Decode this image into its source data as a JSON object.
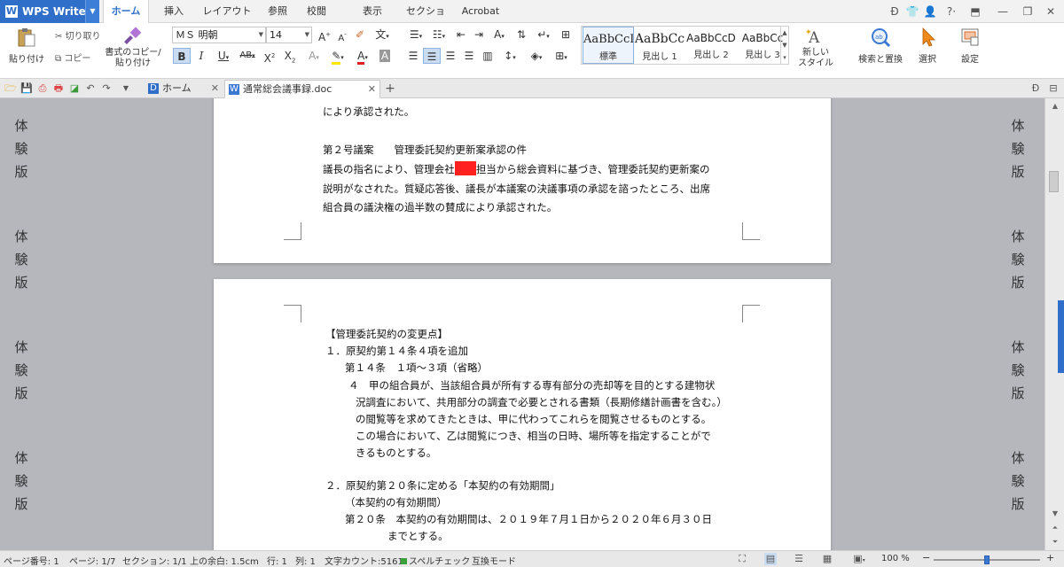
{
  "app": {
    "name": "WPS Writer"
  },
  "menu": [
    "ホーム",
    "挿入",
    "レイアウト",
    "参照",
    "校閲",
    "表示",
    "セクション",
    "Acrobat"
  ],
  "ribbon": {
    "paste_label": "貼り付け",
    "cut_label": "切り取り",
    "copy_label": "コピー",
    "format_painter_label_1": "書式のコピー/",
    "format_painter_label_2": "貼り付け",
    "font_name": "ＭＳ 明朝",
    "font_size": "14",
    "styles": [
      {
        "sample": "AaBbCcI",
        "name": "標準"
      },
      {
        "sample": "AaBbCc",
        "name": "見出し 1"
      },
      {
        "sample": "AaBbCcD",
        "name": "見出し 2"
      },
      {
        "sample": "AaBbCc",
        "name": "見出し 3"
      }
    ],
    "new_style_label_1": "新しい",
    "new_style_label_2": "スタイル",
    "find_replace_label": "検索と置換",
    "select_label": "選択",
    "settings_label": "設定"
  },
  "tabs": [
    {
      "label": "ホーム",
      "active": false
    },
    {
      "label": "通常総会議事録.doc",
      "active": true
    }
  ],
  "watermark": [
    "体",
    "験",
    "版"
  ],
  "page1": {
    "lines": [
      "により承認された。",
      "第２号議案　　管理委託契約更新案承認の件",
      "議長の指名により、管理会社",
      "担当から総会資料に基づき、管理委託契約更新案の",
      "説明がなされた。質疑応答後、議長が本議案の決議事項の承認を諮ったところ、出席",
      "組合員の議決権の過半数の賛成により承認された。"
    ]
  },
  "page2": {
    "lines": [
      "【管理委託契約の変更点】",
      "１．原契約第１４条４項を追加",
      "第１４条　１項～３項（省略）",
      "４　甲の組合員が、当該組合員が所有する専有部分の売却等を目的とする建物状",
      "況調査において、共用部分の調査で必要とされる書類（長期修繕計画書を含む。）",
      "の閲覧等を求めてきたときは、甲に代わってこれらを閲覧させるものとする。",
      "この場合において、乙は閲覧につき、相当の日時、場所等を指定することがで",
      "きるものとする。",
      "２．原契約第２０条に定める「本契約の有効期間」",
      "（本契約の有効期間）",
      "第２０条　本契約の有効期間は、２０１９年７月１日から２０２０年６月３０日",
      "までとする。"
    ]
  },
  "status": {
    "page_number": "ページ番号: 1",
    "page": "ページ: 1/7",
    "section": "セクション: 1/1",
    "top_margin": "上の余白: 1.5cm",
    "row": "行: 1",
    "col": "列: 1",
    "char_count": "文字カウント:5161",
    "spellcheck": "スペルチェック",
    "compat_mode": "互換モード",
    "zoom": "100 %",
    "zoom_fraction": 0.5
  },
  "colors": {
    "accent": "#2f6fc9",
    "redact": "#ff2020"
  }
}
